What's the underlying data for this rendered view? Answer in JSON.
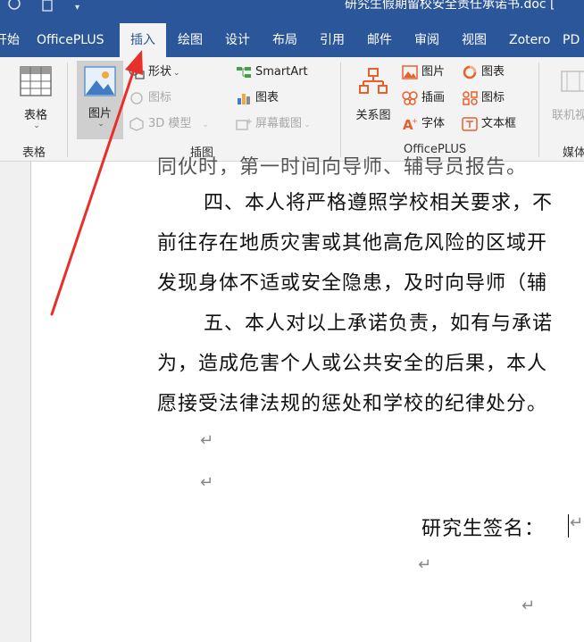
{
  "titlebar": {
    "doc_title": "研究生假期留校安全责任承诺书.doc [",
    "qat_items": [
      "autosave-icon",
      "new-document-icon",
      "customize-qat-icon"
    ]
  },
  "tabs": [
    {
      "label": "开始"
    },
    {
      "label": "OfficePLUS"
    },
    {
      "label": "插入",
      "active": true
    },
    {
      "label": "绘图"
    },
    {
      "label": "设计"
    },
    {
      "label": "布局"
    },
    {
      "label": "引用"
    },
    {
      "label": "邮件"
    },
    {
      "label": "审阅"
    },
    {
      "label": "视图"
    },
    {
      "label": "Zotero"
    },
    {
      "label": "PD"
    }
  ],
  "ribbon": {
    "tables_group": {
      "button": "表格",
      "label": "表格"
    },
    "illustrations_group": {
      "label": "插图",
      "picture": "图片",
      "shapes": "形状",
      "icons": "图标",
      "models3d": "3D 模型",
      "smartart": "SmartArt",
      "chart": "图表",
      "screenshot": "屏幕截图"
    },
    "officeplus_group": {
      "label": "OfficePLUS",
      "relation": "关系图",
      "picture": "图片",
      "illustration": "插画",
      "font": "字体",
      "chart": "图表",
      "icon": "图标",
      "textbox": "文本框"
    },
    "media_group": {
      "button": "联机视",
      "label": "媒体"
    }
  },
  "document": {
    "lines": [
      "同伙时，第一时间向导师、辅导员报告。",
      "四、本人将严格遵照学校相关要求，不",
      "前往存在地质灾害或其他高危风险的区域开",
      "发现身体不适或安全隐患，及时向导师（辅",
      "五、本人对以上承诺负责，如有与承诺",
      "为，造成危害个人或公共安全的后果，本人",
      "愿接受法律法规的惩处和学校的纪律处分。"
    ],
    "paragraph_mark": "↵",
    "signature_label": "研究生签名："
  },
  "colors": {
    "word_blue": "#2b579a",
    "arrow": "#e8302a",
    "ribbon_bg": "#f3f3f3"
  }
}
